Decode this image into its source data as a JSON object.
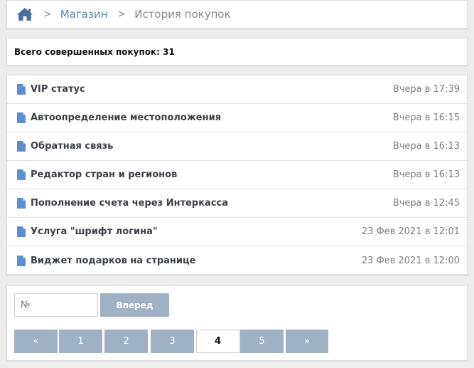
{
  "breadcrumb": {
    "home_icon": "home-icon",
    "shop_label": "Магазин",
    "current_label": "История покупок",
    "separator": ">"
  },
  "summary": {
    "total_text": "Всего совершенных покупок: 31"
  },
  "purchases": [
    {
      "title": "VIP статус",
      "date": "Вчера в 17:39"
    },
    {
      "title": "Автоопределение местоположения",
      "date": "Вчера в 16:15"
    },
    {
      "title": "Обратная связь",
      "date": "Вчера в 16:13"
    },
    {
      "title": "Редактор стран и регионов",
      "date": "Вчера в 16:13"
    },
    {
      "title": "Пополнение счета через Интеркасса",
      "date": "Вчера в 12:45"
    },
    {
      "title": "Услуга \"шрифт логина\"",
      "date": "23 Фев 2021 в 12:01"
    },
    {
      "title": "Виджет подарков на странице",
      "date": "23 Фев 2021 в 12:00"
    }
  ],
  "pagination": {
    "input_placeholder": "№",
    "go_label": "Вперед",
    "prev_label": "«",
    "next_label": "»",
    "pages": [
      "1",
      "2",
      "3",
      "4",
      "5"
    ],
    "current_page": "4"
  },
  "colors": {
    "accent": "#5f84ad",
    "button": "#9fb2c5",
    "doc_icon": "#5b8fd0",
    "background": "#ededed"
  }
}
